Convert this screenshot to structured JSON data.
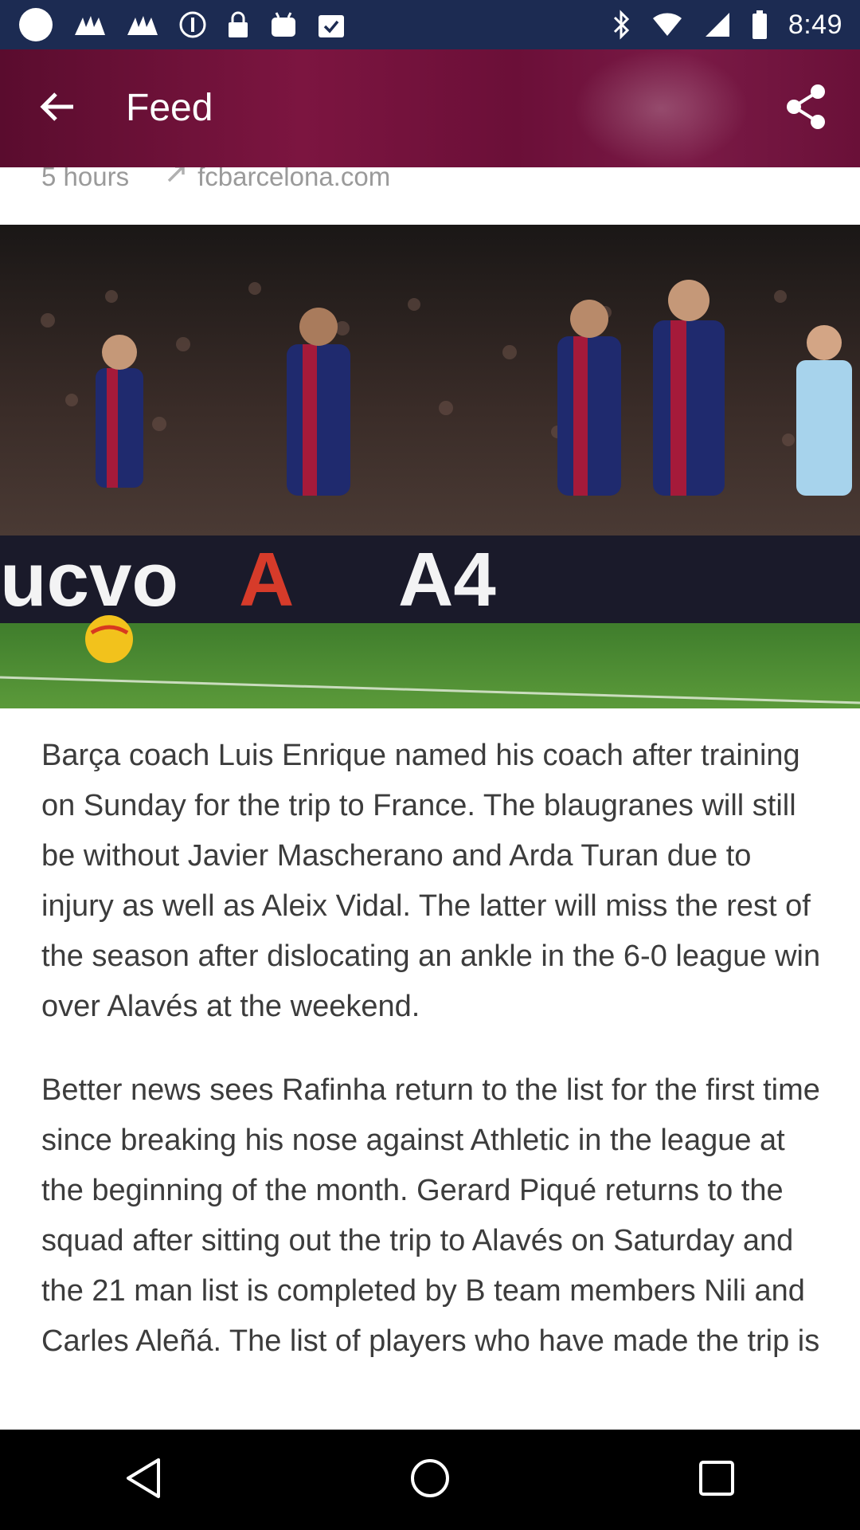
{
  "status_bar": {
    "time": "8:49",
    "icons_left": [
      "circle-icon",
      "bird-icon",
      "bird-icon",
      "info-icon",
      "lock-icon",
      "android-icon",
      "checklist-icon"
    ],
    "icons_right": [
      "bluetooth-icon",
      "wifi-icon",
      "signal-icon",
      "battery-icon"
    ]
  },
  "app_bar": {
    "title": "Feed",
    "back_icon": "arrow-back-icon",
    "share_icon": "share-icon",
    "color": "#6e1239"
  },
  "article": {
    "age": "5 hours",
    "source": "fcbarcelona.com",
    "paragraphs": [
      "Barça coach Luis Enrique named his coach after training on Sunday for the trip to France. The blaugranes will still be without Javier Mascherano and Arda Turan due to injury as well as Aleix Vidal. The latter will miss the rest of the season after dislocating an ankle in the 6-0 league win over Alavés at the weekend.",
      "Better news sees Rafinha return to the list for the first time since breaking his nose against Athletic in the league at the beginning of the month. Gerard Piqué returns to the squad after sitting out the trip to Alavés on Saturday and the 21 man list is completed by B team members Nili and Carles Aleñá. The list of players who have made the trip is"
    ]
  },
  "nav_bar": {
    "back_icon": "triangle-back-icon",
    "home_icon": "circle-home-icon",
    "recents_icon": "square-recents-icon"
  }
}
